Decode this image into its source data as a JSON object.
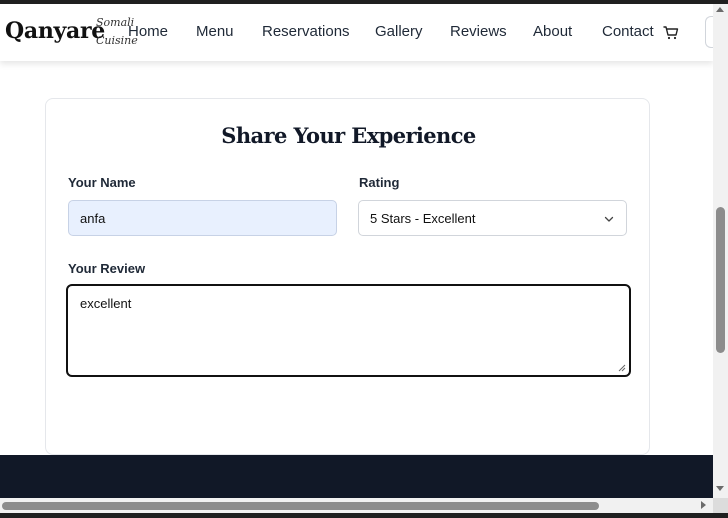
{
  "brand": {
    "name": "Qanyare",
    "subtitle_line1": "Somali",
    "subtitle_line2": "Cuisine"
  },
  "nav": [
    {
      "label": "Home"
    },
    {
      "label": "Menu"
    },
    {
      "label": "Reservations"
    },
    {
      "label": "Gallery"
    },
    {
      "label": "Reviews"
    },
    {
      "label": "About"
    },
    {
      "label": "Contact"
    }
  ],
  "icons": {
    "cart": "shopping-cart-icon",
    "select_arrow": "chevron-down-icon"
  },
  "form": {
    "title": "Share Your Experience",
    "name_label": "Your Name",
    "name_value": "anfa",
    "rating_label": "Rating",
    "rating_value": "5 Stars - Excellent",
    "review_label": "Your Review",
    "review_value": "excellent"
  },
  "colors": {
    "footer": "#111827",
    "autofill": "#e8f0fe"
  }
}
